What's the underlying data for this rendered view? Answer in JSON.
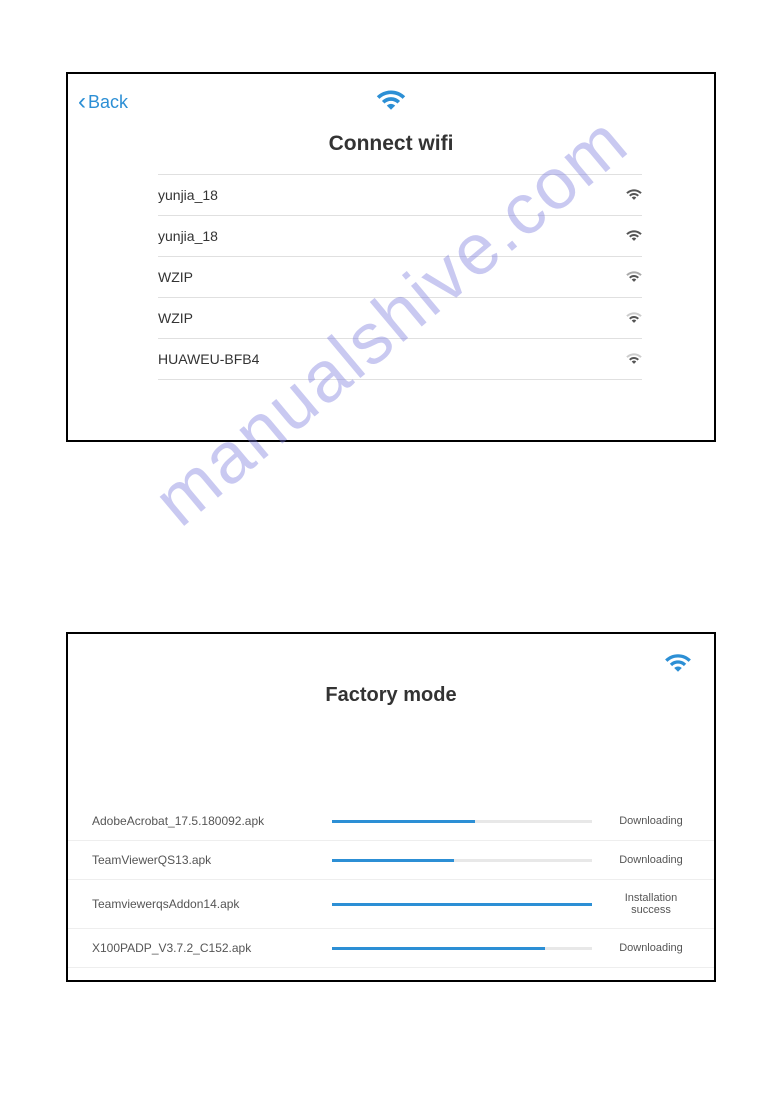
{
  "panel1": {
    "back_label": "Back",
    "title": "Connect wifi",
    "networks": [
      {
        "ssid": "yunjia_18",
        "strength": "strong"
      },
      {
        "ssid": "yunjia_18",
        "strength": "strong"
      },
      {
        "ssid": "WZIP",
        "strength": "medium"
      },
      {
        "ssid": "WZIP",
        "strength": "weak"
      },
      {
        "ssid": "HUAWEU-BFB4",
        "strength": "weak"
      }
    ]
  },
  "panel2": {
    "title": "Factory mode",
    "downloads": [
      {
        "filename": "AdobeAcrobat_17.5.180092.apk",
        "progress": 55,
        "status": "Downloading"
      },
      {
        "filename": "TeamViewerQS13.apk",
        "progress": 47,
        "status": "Downloading"
      },
      {
        "filename": "TeamviewerqsAddon14.apk",
        "progress": 100,
        "status": "Installation success"
      },
      {
        "filename": "X100PADP_V3.7.2_C152.apk",
        "progress": 82,
        "status": "Downloading"
      }
    ]
  },
  "watermark": "manualshive.com"
}
